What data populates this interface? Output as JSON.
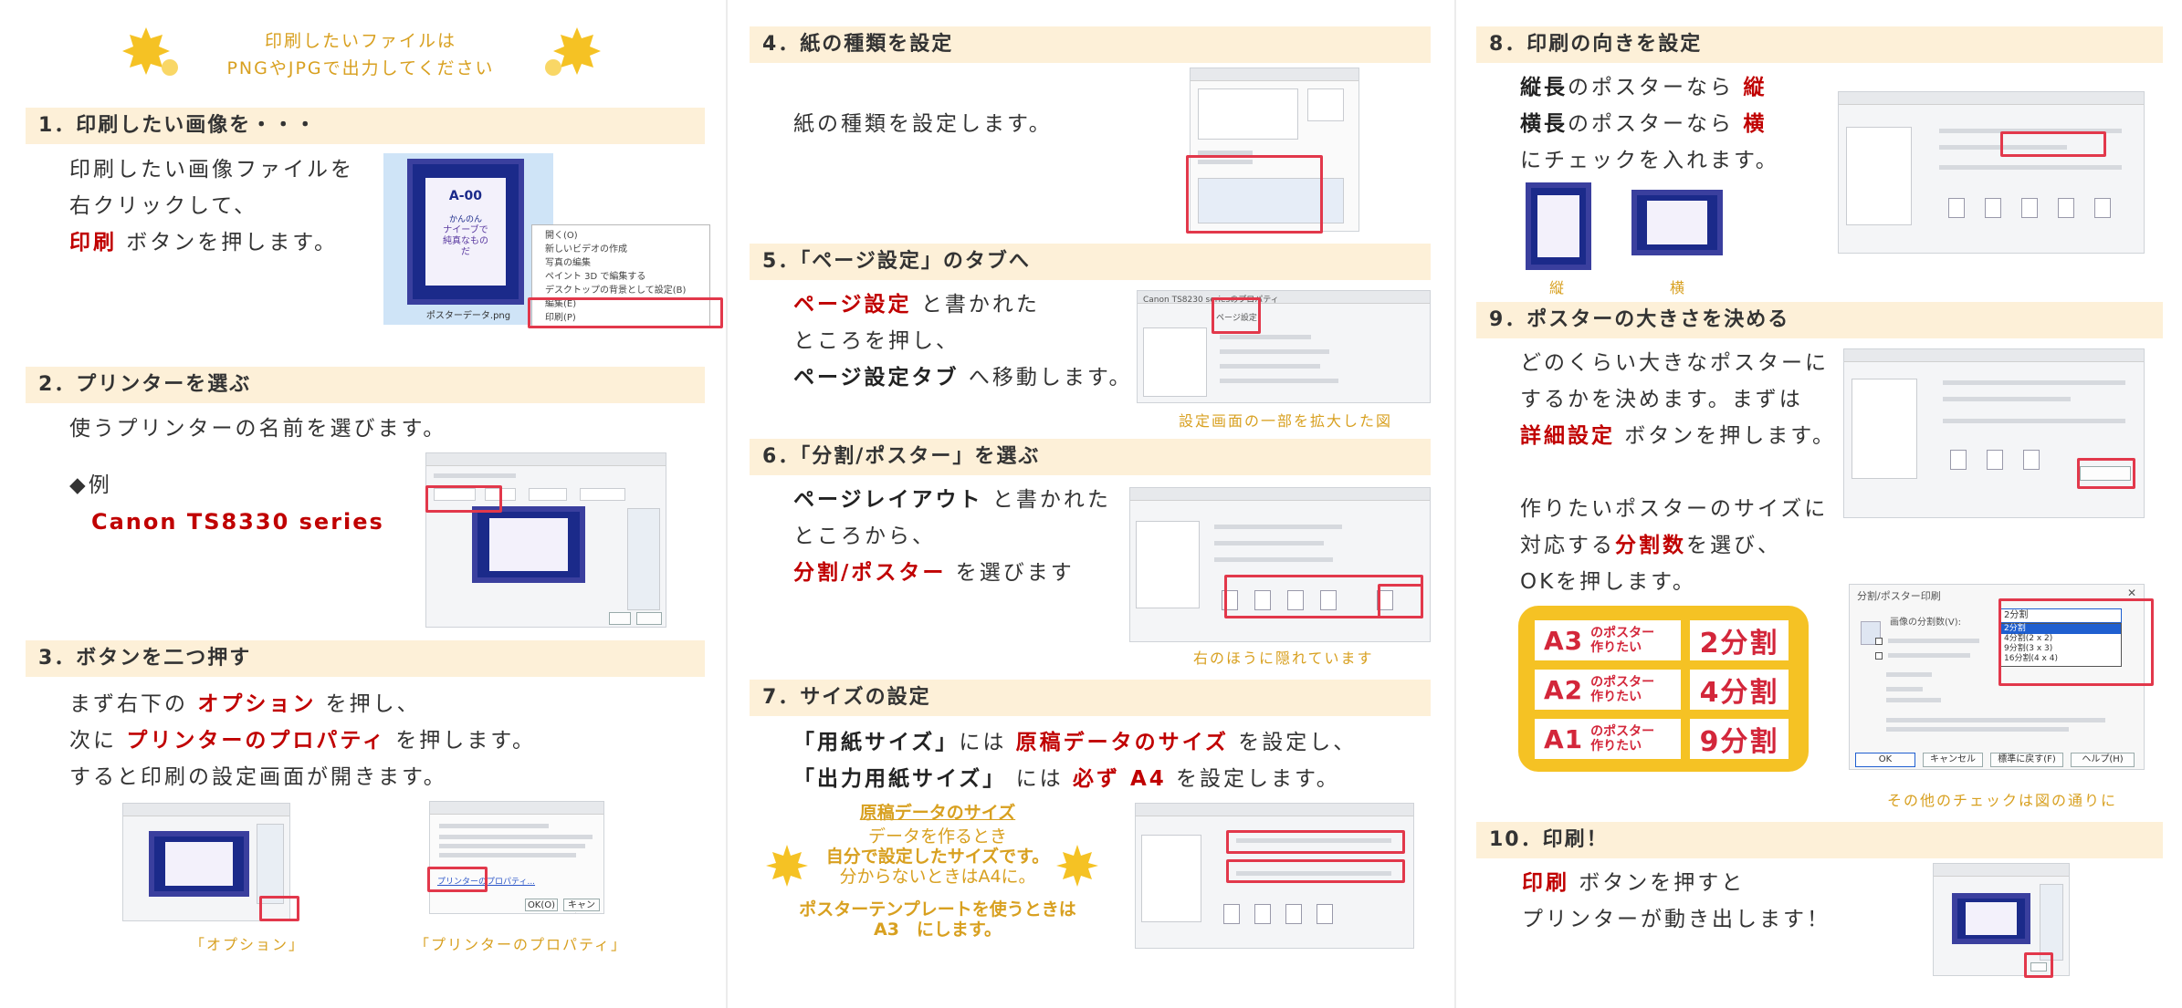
{
  "intro": {
    "line1": "印刷したいファイルは",
    "line2": "PNGやJPGで出力してください"
  },
  "s1": {
    "title": "1．印刷したい画像を・・・",
    "l1": "印刷したい画像ファイルを",
    "l2": "右クリックして、",
    "l3_red": "印刷",
    "l3": " ボタンを押します。",
    "file": "ポスターデータ.png",
    "poster_title": "A-00",
    "poster_sub": "かんのん",
    "poster_text": "ナイーブで純真なものだ",
    "menu": [
      "開く(O)",
      "新しいビデオの作成",
      "写真の編集",
      "ペイント 3D で編集する",
      "デスクトップの背景として設定(B)",
      "編集(E)",
      "印刷(P)"
    ]
  },
  "s2": {
    "title": "2．プリンターを選ぶ",
    "l1": "使うプリンターの名前を選びます。",
    "ex": "◆例",
    "printer": "Canon TS8330 series"
  },
  "s3": {
    "title": "3．ボタンを二つ押す",
    "l1a": "まず右下の ",
    "l1b": "オプション",
    "l1c": " を押し、",
    "l2a": "次に ",
    "l2b": "プリンターのプロパティ",
    "l2c": " を押します。",
    "l3": "すると印刷の設定画面が開きます。",
    "cap1": "「オプション」",
    "cap2": "「プリンターのプロパティ」",
    "dlg_ok": "OK(O)",
    "dlg_cancel": "キャンセル",
    "dlg_link": "プリンターのプロパティ..."
  },
  "s4": {
    "title": "4．紙の種類を設定",
    "l1": "紙の種類を設定します。"
  },
  "s5": {
    "title": "5．「ページ設定」のタブへ",
    "l1a": "ページ設定",
    "l1b": " と書かれた",
    "l2": "ところを押し、",
    "l3a": "ページ設定タブ",
    "l3b": " へ移動します。",
    "cap": "設定画面の一部を拡大した図",
    "dlg_title": "Canon TS8230 seriesのプロパティ",
    "tab": "ページ設定"
  },
  "s6": {
    "title": "6．「分割/ポスター」を選ぶ",
    "l1a": "ページレイアウト",
    "l1b": " と書かれた",
    "l2": "ところから、",
    "l3a": "分割/ポスター",
    "l3b": " を選びます",
    "cap": "右のほうに隠れています"
  },
  "s7": {
    "title": "7．サイズの設定",
    "l1a": "「",
    "l1b": "用紙サイズ」",
    "l1c": "には ",
    "l1d": "原稿データのサイズ",
    "l1e": " を設定し、",
    "l2a": "「出力用紙サイズ」",
    "l2b": " には ",
    "l2c": "必ず A4",
    "l2d": " を設定します。",
    "note_head": "原稿データのサイズ",
    "note1": "データを作るとき",
    "note2": "自分で設定したサイズです。",
    "note3": "分からないときはA4に。",
    "note4": "ポスターテンプレートを使うときは",
    "note5": "A3　にします。"
  },
  "s8": {
    "title": "8．印刷の向きを設定",
    "l1a": "縦長",
    "l1b": "のポスターなら ",
    "l1c": "縦",
    "l2a": "横長",
    "l2b": "のポスターなら ",
    "l2c": "横",
    "l3": "にチェックを入れます。",
    "cap_v": "縦",
    "cap_h": "横"
  },
  "s9": {
    "title": "9．ポスターの大きさを決める",
    "l1": "どのくらい大きなポスターに",
    "l2": "するかを決めます。まずは",
    "l3a": "詳細設定",
    "l3b": " ボタンを押します。",
    "l4": "作りたいポスターのサイズに",
    "l5a": "対応する",
    "l5b": "分割数",
    "l5c": "を選び、",
    "l6": "OKを押します。",
    "cap": "その他のチェックは図の通りに",
    "rows": [
      {
        "size": "A3",
        "sub1": "のポスター",
        "sub2": "作りたい",
        "div": "2分割"
      },
      {
        "size": "A2",
        "sub1": "のポスター",
        "sub2": "作りたい",
        "div": "4分割"
      },
      {
        "size": "A1",
        "sub1": "のポスター",
        "sub2": "作りたい",
        "div": "9分割"
      }
    ],
    "dlg_title": "分割/ポスター印刷",
    "dlg_label": "画像の分割数(V):",
    "dlg_opts": [
      "2分割",
      "4分割(2 x 2)",
      "9分割(3 x 3)",
      "16分割(4 x 4)"
    ],
    "dlg_ok": "OK",
    "dlg_cancel": "キャンセル",
    "dlg_default": "標準に戻す(F)",
    "dlg_help": "ヘルプ(H)"
  },
  "s10": {
    "title": "10．印刷！",
    "l1a": "印刷",
    "l1b": " ボタンを押すと",
    "l2": "プリンターが動き出します！"
  },
  "colors": {
    "header_bg": "#fdf0d8",
    "accent_red": "#c00000",
    "gold": "#d8a020",
    "table_bg": "#f5c224",
    "highlight": "#e2384b"
  }
}
